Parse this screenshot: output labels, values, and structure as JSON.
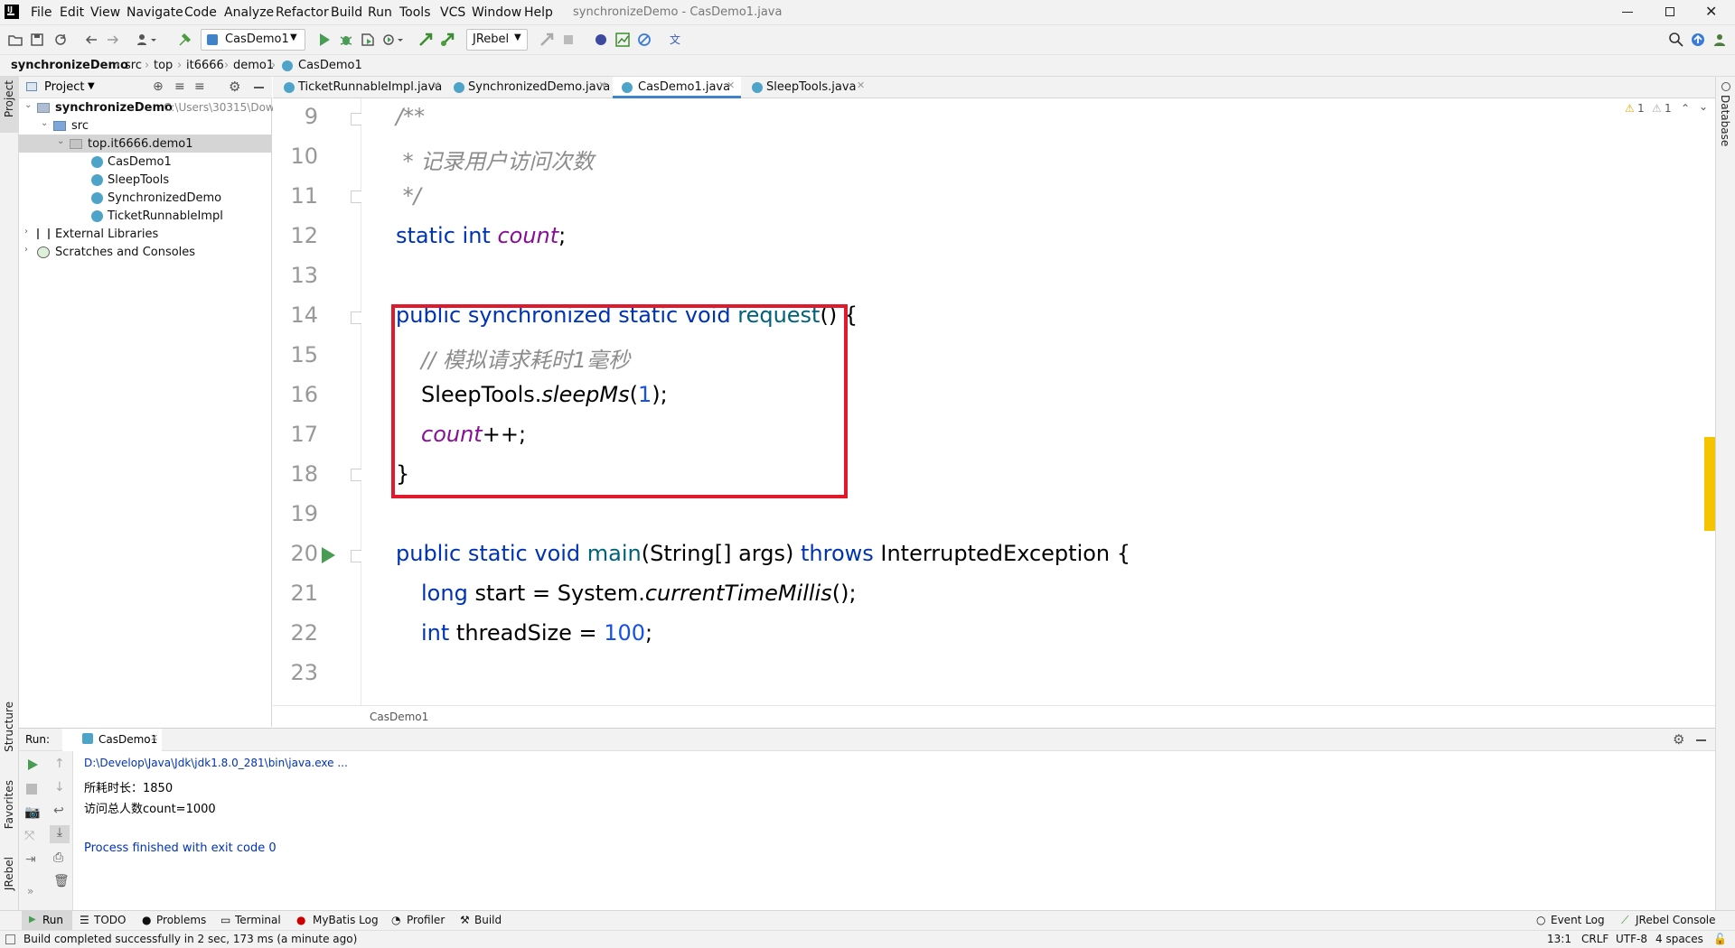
{
  "window": {
    "title": "synchronizeDemo - CasDemo1.java"
  },
  "menu": [
    "File",
    "Edit",
    "View",
    "Navigate",
    "Code",
    "Analyze",
    "Refactor",
    "Build",
    "Run",
    "Tools",
    "VCS",
    "Window",
    "Help"
  ],
  "toolbar": {
    "run_config": "CasDemo1",
    "jrebel": "JRebel"
  },
  "breadcrumb": [
    "synchronizeDemo",
    "src",
    "top",
    "it6666",
    "demo1",
    "CasDemo1"
  ],
  "project": {
    "header": "Project",
    "root": "synchronizeDemo",
    "root_path": "C:\\Users\\30315\\Dow",
    "src": "src",
    "package": "top.it6666.demo1",
    "files": [
      "CasDemo1",
      "SleepTools",
      "SynchronizedDemo",
      "TicketRunnableImpl"
    ],
    "external": "External Libraries",
    "scratches": "Scratches and Consoles"
  },
  "tabs": [
    "TicketRunnableImpl.java",
    "SynchronizedDemo.java",
    "CasDemo1.java",
    "SleepTools.java"
  ],
  "editor": {
    "line_numbers": [
      "9",
      "10",
      "11",
      "12",
      "13",
      "14",
      "15",
      "16",
      "17",
      "18",
      "19",
      "20",
      "21",
      "22",
      "23"
    ],
    "code": {
      "l9": "/**",
      "l10": " * 记录用户访问次数",
      "l11": " */",
      "l12_kw": "static int ",
      "l12_fld": "count",
      "l12_end": ";",
      "l14_kw": "public synchronized static void ",
      "l14_fn": "request",
      "l14_end": "() {",
      "l15": "// 模拟请求耗时1毫秒",
      "l16_a": "SleepTools.",
      "l16_b": "sleepMs",
      "l16_c": "(",
      "l16_d": "1",
      "l16_e": ");",
      "l17_fld": "count",
      "l17_end": "++;",
      "l18": "}",
      "l20_kw": "public static void ",
      "l20_fn": "main",
      "l20_mid": "(String[] args) ",
      "l20_kw2": "throws ",
      "l20_end": "InterruptedException {",
      "l21_kw": "long ",
      "l21_a": "start = System.",
      "l21_b": "currentTimeMillis",
      "l21_c": "();",
      "l22_kw": "int ",
      "l22_a": "threadSize = ",
      "l22_num": "100",
      "l22_end": ";"
    },
    "inspection_warn": "1",
    "inspection_weak": "1",
    "breadcrumb": "CasDemo1"
  },
  "run": {
    "label": "Run:",
    "tab": "CasDemo1",
    "output": [
      "D:\\Develop\\Java\\Jdk\\jdk1.8.0_281\\bin\\java.exe ...",
      "所耗时长：1850",
      "访问总人数count=1000",
      "",
      "Process finished with exit code 0"
    ]
  },
  "side": {
    "project": "Project",
    "structure": "Structure",
    "favorites": "Favorites",
    "jrebel": "JRebel",
    "database": "Database"
  },
  "bottom_tools": [
    "Run",
    "TODO",
    "Problems",
    "Terminal",
    "MyBatis Log",
    "Profiler",
    "Build"
  ],
  "bottom_right_tools": [
    "Event Log",
    "JRebel Console"
  ],
  "status": {
    "message": "Build completed successfully in 2 sec, 173 ms (a minute ago)",
    "position": "13:1",
    "line_sep": "CRLF",
    "encoding": "UTF-8",
    "indent": "4 spaces"
  },
  "colors": {
    "keyword": "#0033b3",
    "field": "#871094",
    "comment": "#8c8c8c",
    "number": "#1750eb",
    "highlight_box": "#e0192d",
    "output_link": "#0033b3"
  }
}
